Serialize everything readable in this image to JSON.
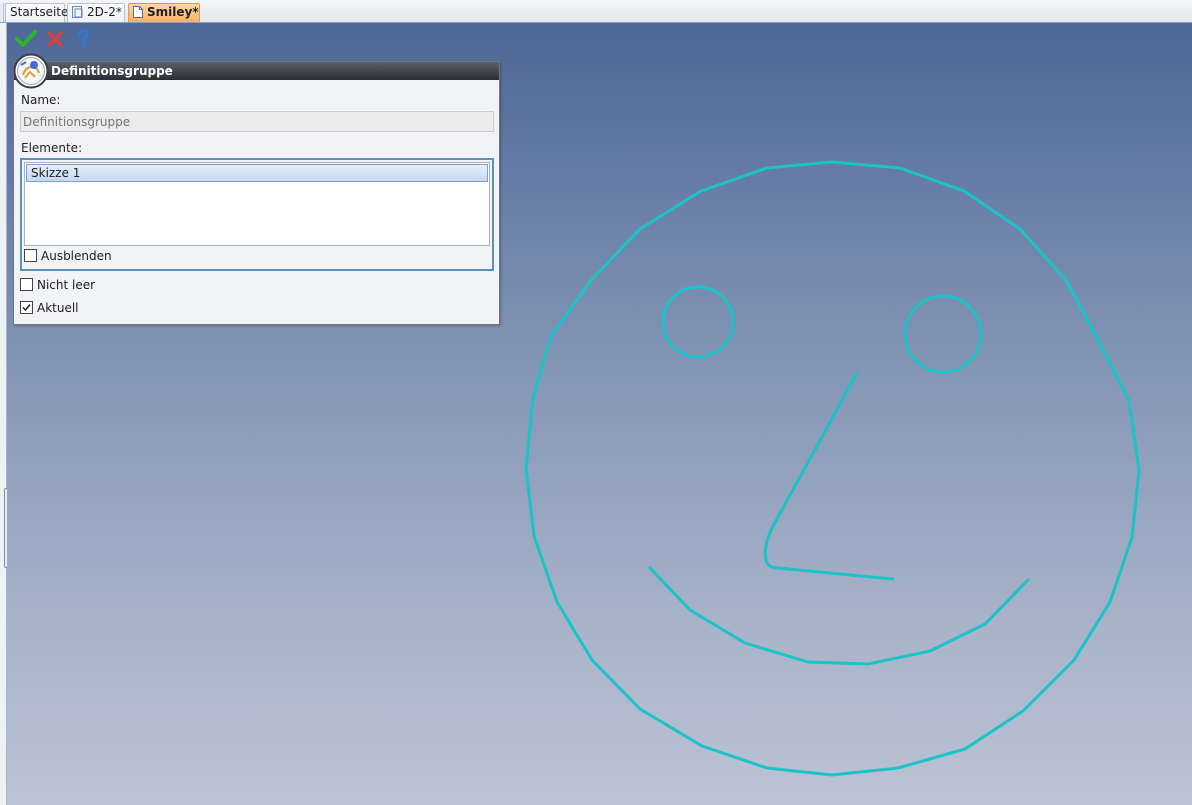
{
  "tabs": [
    {
      "label": "Startseite",
      "active": false
    },
    {
      "label": "2D-2*",
      "active": false,
      "icon": "sketch-doc-icon"
    },
    {
      "label": "Smiley*",
      "active": true,
      "icon": "document-icon"
    }
  ],
  "toolbar": {
    "ok_icon": "checkmark-icon",
    "cancel_icon": "close-icon",
    "help_icon": "help-icon"
  },
  "panel": {
    "title": "Definitionsgruppe",
    "badge_icon": "definition-group-icon",
    "name_label": "Name:",
    "name_placeholder": "Definitionsgruppe",
    "name_value": "",
    "elements_label": "Elemente:",
    "elements": [
      "Skizze 1"
    ],
    "hide_label": "Ausblenden",
    "hide_checked": false,
    "not_empty_label": "Nicht leer",
    "not_empty_checked": false,
    "current_label": "Aktuell",
    "current_checked": true
  },
  "colors": {
    "sketch_line": "#19c3c8",
    "viewport_top": "#4d6797",
    "viewport_bottom": "#bcc3d4",
    "active_tab": "#f7b06b",
    "panel_header": "#2b2d33"
  }
}
